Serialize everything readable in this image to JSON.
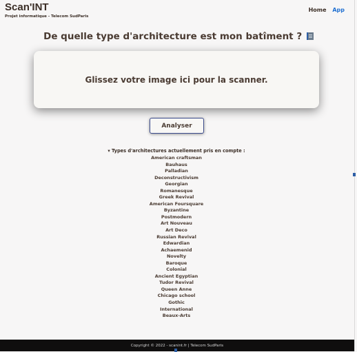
{
  "header": {
    "title": "Scan'INT",
    "subtitle": "Projet informatique - Telecom SudParis",
    "nav": [
      {
        "label": "Home",
        "color": "#3b2e26"
      },
      {
        "label": "App",
        "color": "#1f6fd1"
      }
    ]
  },
  "main": {
    "question": "De quelle type d'architecture est mon batîment ?",
    "question_icon": "building-icon",
    "dropzone_text": "Glissez votre image ici pour la scanner.",
    "analyze_label": "Analyser"
  },
  "types": {
    "summary": "▾ Types d'architectures actuellement pris en compte :",
    "items": [
      "American craftsman",
      "Bauhaus",
      "Palladian",
      "Deconstructivism",
      "Georgian",
      "Romanesque",
      "Greek Revival",
      "American Foursquare",
      "Byzantine",
      "Postmodern",
      "Art Nouveau",
      "Art Deco",
      "Russian Revival",
      "Edwardian",
      "Achaemenid",
      "Novelty",
      "Baroque",
      "Colonial",
      "Ancient Egyptian",
      "Tudor Revival",
      "Queen Anne",
      "Chicago school",
      "Gothic",
      "International",
      "Beaux-Arts"
    ]
  },
  "footer": {
    "text": "Copyright © 2022 - scanint.fr | Telecom SudParis"
  },
  "colors": {
    "accent": "#1f6fd1",
    "text": "#4a3b32",
    "footer_bg": "#0f0e0e"
  }
}
